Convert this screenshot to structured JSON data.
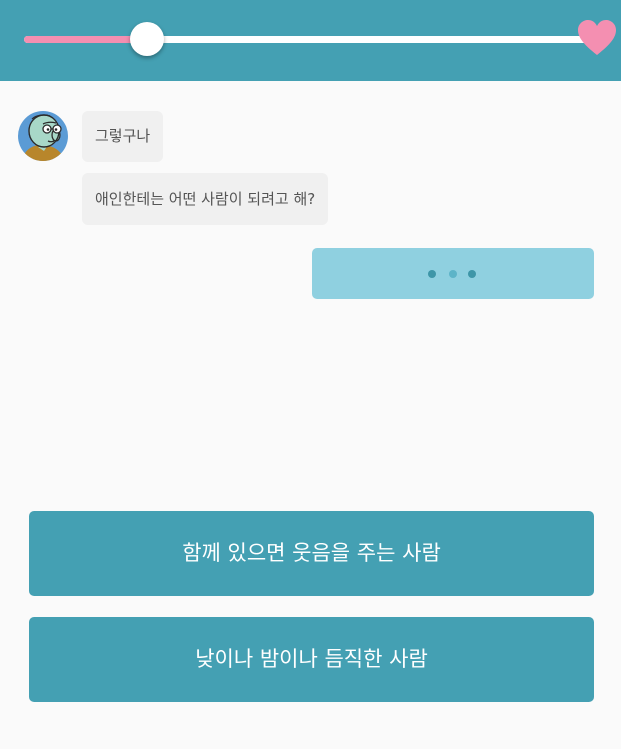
{
  "progress": {
    "value": 0.215,
    "track_color": "#ffffff",
    "fill_color": "#f48fb1",
    "end_icon": "heart-icon",
    "end_icon_color": "#f48fb1"
  },
  "chat": {
    "avatar_icon": "character-avatar",
    "messages": [
      {
        "text": "그렇구나"
      },
      {
        "text": "애인한테는 어떤 사람이 되려고 해?"
      }
    ],
    "typing_indicator_icon": "typing-dots-icon"
  },
  "choices": [
    {
      "label": "함께 있으면 웃음을 주는 사람"
    },
    {
      "label": "낮이나 밤이나 듬직한 사람"
    }
  ],
  "colors": {
    "header_bg": "#44a0b3",
    "button_bg": "#44a0b3",
    "typing_bg": "#8fd0e0",
    "page_bg": "#fafafa"
  }
}
